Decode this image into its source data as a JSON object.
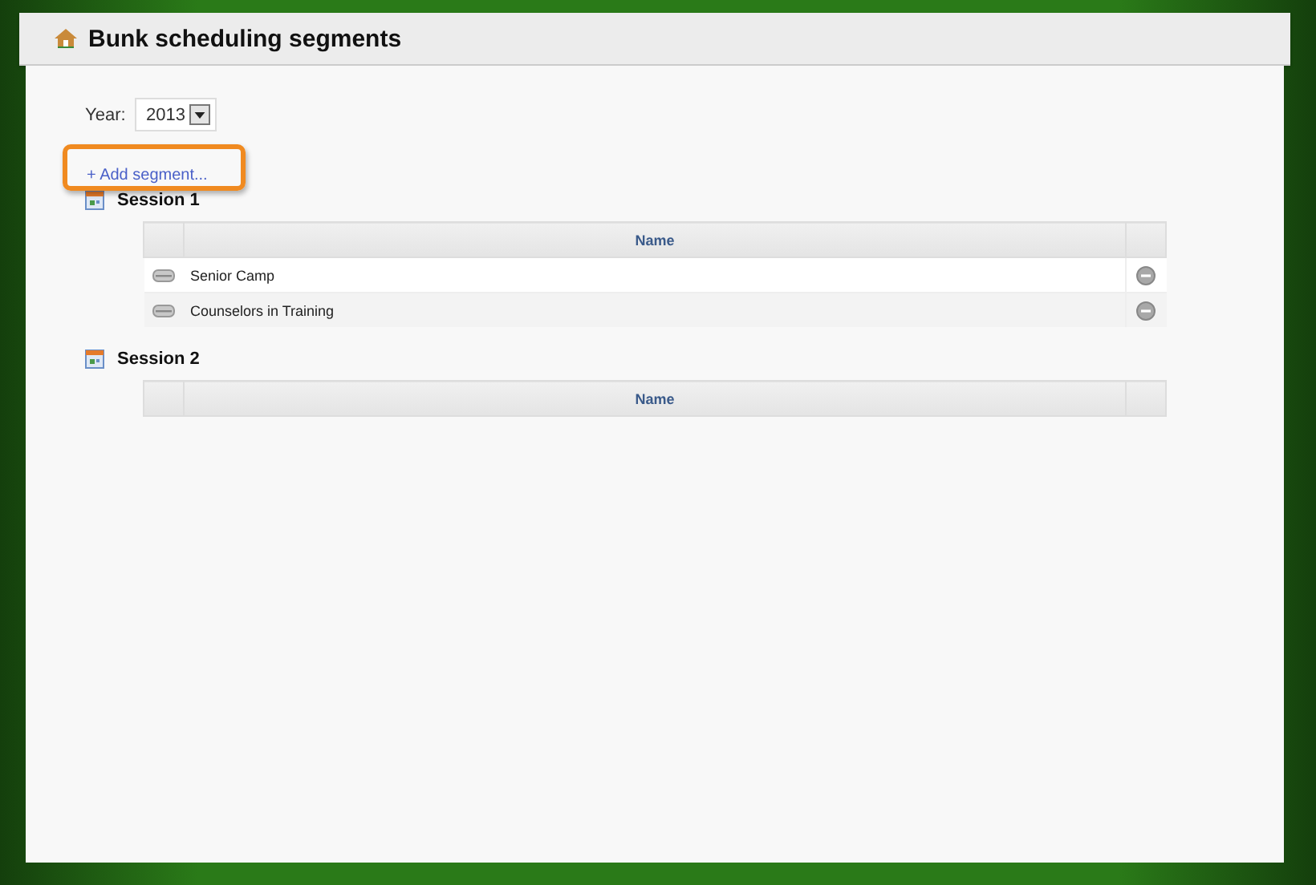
{
  "page": {
    "title": "Bunk scheduling segments"
  },
  "year": {
    "label": "Year:",
    "value": "2013"
  },
  "add_link": {
    "label": "+ Add segment...",
    "highlighted": true
  },
  "sessions": [
    {
      "title": "Session 1",
      "columns": [
        "Name"
      ],
      "rows": [
        {
          "name": "Senior Camp"
        },
        {
          "name": "Counselors in Training"
        }
      ]
    },
    {
      "title": "Session 2",
      "columns": [
        "Name"
      ]
    }
  ]
}
